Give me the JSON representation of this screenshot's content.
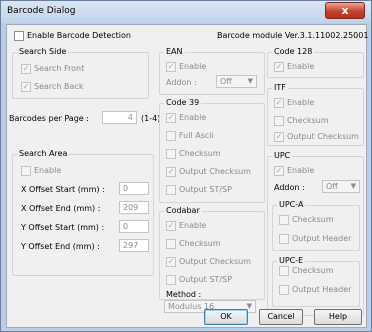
{
  "dialog": {
    "title": "Barcode Dialog",
    "close_glyph": "x",
    "enable_barcode_detection": "Enable Barcode Detection",
    "module_version": "Barcode module Ver.3.1.11002.25001"
  },
  "search_side": {
    "legend": "Search Side",
    "front": "Search Front",
    "back": "Search Back"
  },
  "barcodes_per_page": {
    "label": "Barcodes per Page :",
    "value": "4",
    "range": "(1-4)"
  },
  "search_area": {
    "legend": "Search Area",
    "enable": "Enable",
    "fields": [
      {
        "label": "X Offset Start (mm) :",
        "value": "0"
      },
      {
        "label": "X Offset End (mm) :",
        "value": "209"
      },
      {
        "label": "Y Offset Start (mm) :",
        "value": "0"
      },
      {
        "label": "Y Offset End (mm) :",
        "value": "297"
      }
    ]
  },
  "ean": {
    "legend": "EAN",
    "enable": "Enable",
    "addon_label": "Addon :",
    "addon_value": "Off"
  },
  "code39": {
    "legend": "Code 39",
    "enable": "Enable",
    "full_ascii": "Full Ascii",
    "checksum": "Checksum",
    "output_checksum": "Output Checksum",
    "output_stsp": "Output ST/SP"
  },
  "codabar": {
    "legend": "Codabar",
    "enable": "Enable",
    "checksum": "Checksum",
    "output_checksum": "Output Checksum",
    "output_stsp": "Output ST/SP",
    "method_label": "Method :",
    "method_value": "Modulus 16"
  },
  "code128": {
    "legend": "Code 128",
    "enable": "Enable"
  },
  "itf": {
    "legend": "ITF",
    "enable": "Enable",
    "checksum": "Checksum",
    "output_checksum": "Output Checksum"
  },
  "upc": {
    "legend": "UPC",
    "enable": "Enable",
    "addon_label": "Addon :",
    "addon_value": "Off",
    "upca": {
      "legend": "UPC-A",
      "checksum": "Checksum",
      "output_header": "Output Header"
    },
    "upce": {
      "legend": "UPC-E",
      "checksum": "Checksum",
      "output_header": "Output Header"
    }
  },
  "buttons": {
    "ok": "OK",
    "cancel": "Cancel",
    "help": "Help"
  },
  "glyphs": {
    "check": "✓",
    "dropdown": "▼"
  }
}
